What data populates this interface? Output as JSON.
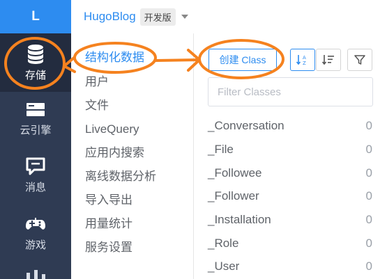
{
  "sidebar": {
    "logo_letter": "L",
    "items": [
      {
        "label": "存储",
        "icon": "database-icon",
        "active": true
      },
      {
        "label": "云引擎",
        "icon": "cloud-engine-icon",
        "active": false
      },
      {
        "label": "消息",
        "icon": "message-icon",
        "active": false
      },
      {
        "label": "游戏",
        "icon": "gamepad-icon",
        "active": false
      }
    ]
  },
  "header": {
    "app_name": "HugoBlog",
    "env_badge": "开发版"
  },
  "submenu": {
    "items": [
      {
        "label": "结构化数据",
        "active": true
      },
      {
        "label": "用户"
      },
      {
        "label": "文件"
      },
      {
        "label": "LiveQuery"
      },
      {
        "label": "应用内搜索"
      },
      {
        "label": "离线数据分析"
      },
      {
        "label": "导入导出"
      },
      {
        "label": "用量统计"
      },
      {
        "label": "服务设置"
      }
    ]
  },
  "main": {
    "create_button_label": "创建 Class",
    "filter_placeholder": "Filter Classes",
    "classes": [
      {
        "name": "_Conversation",
        "count": "0"
      },
      {
        "name": "_File",
        "count": "0"
      },
      {
        "name": "_Followee",
        "count": "0"
      },
      {
        "name": "_Follower",
        "count": "0"
      },
      {
        "name": "_Installation",
        "count": "0"
      },
      {
        "name": "_Role",
        "count": "0"
      },
      {
        "name": "_User",
        "count": "0"
      }
    ]
  },
  "colors": {
    "accent": "#2d8cf0",
    "sidebar_bg": "#2f3b53",
    "annotation": "#f5821f"
  }
}
